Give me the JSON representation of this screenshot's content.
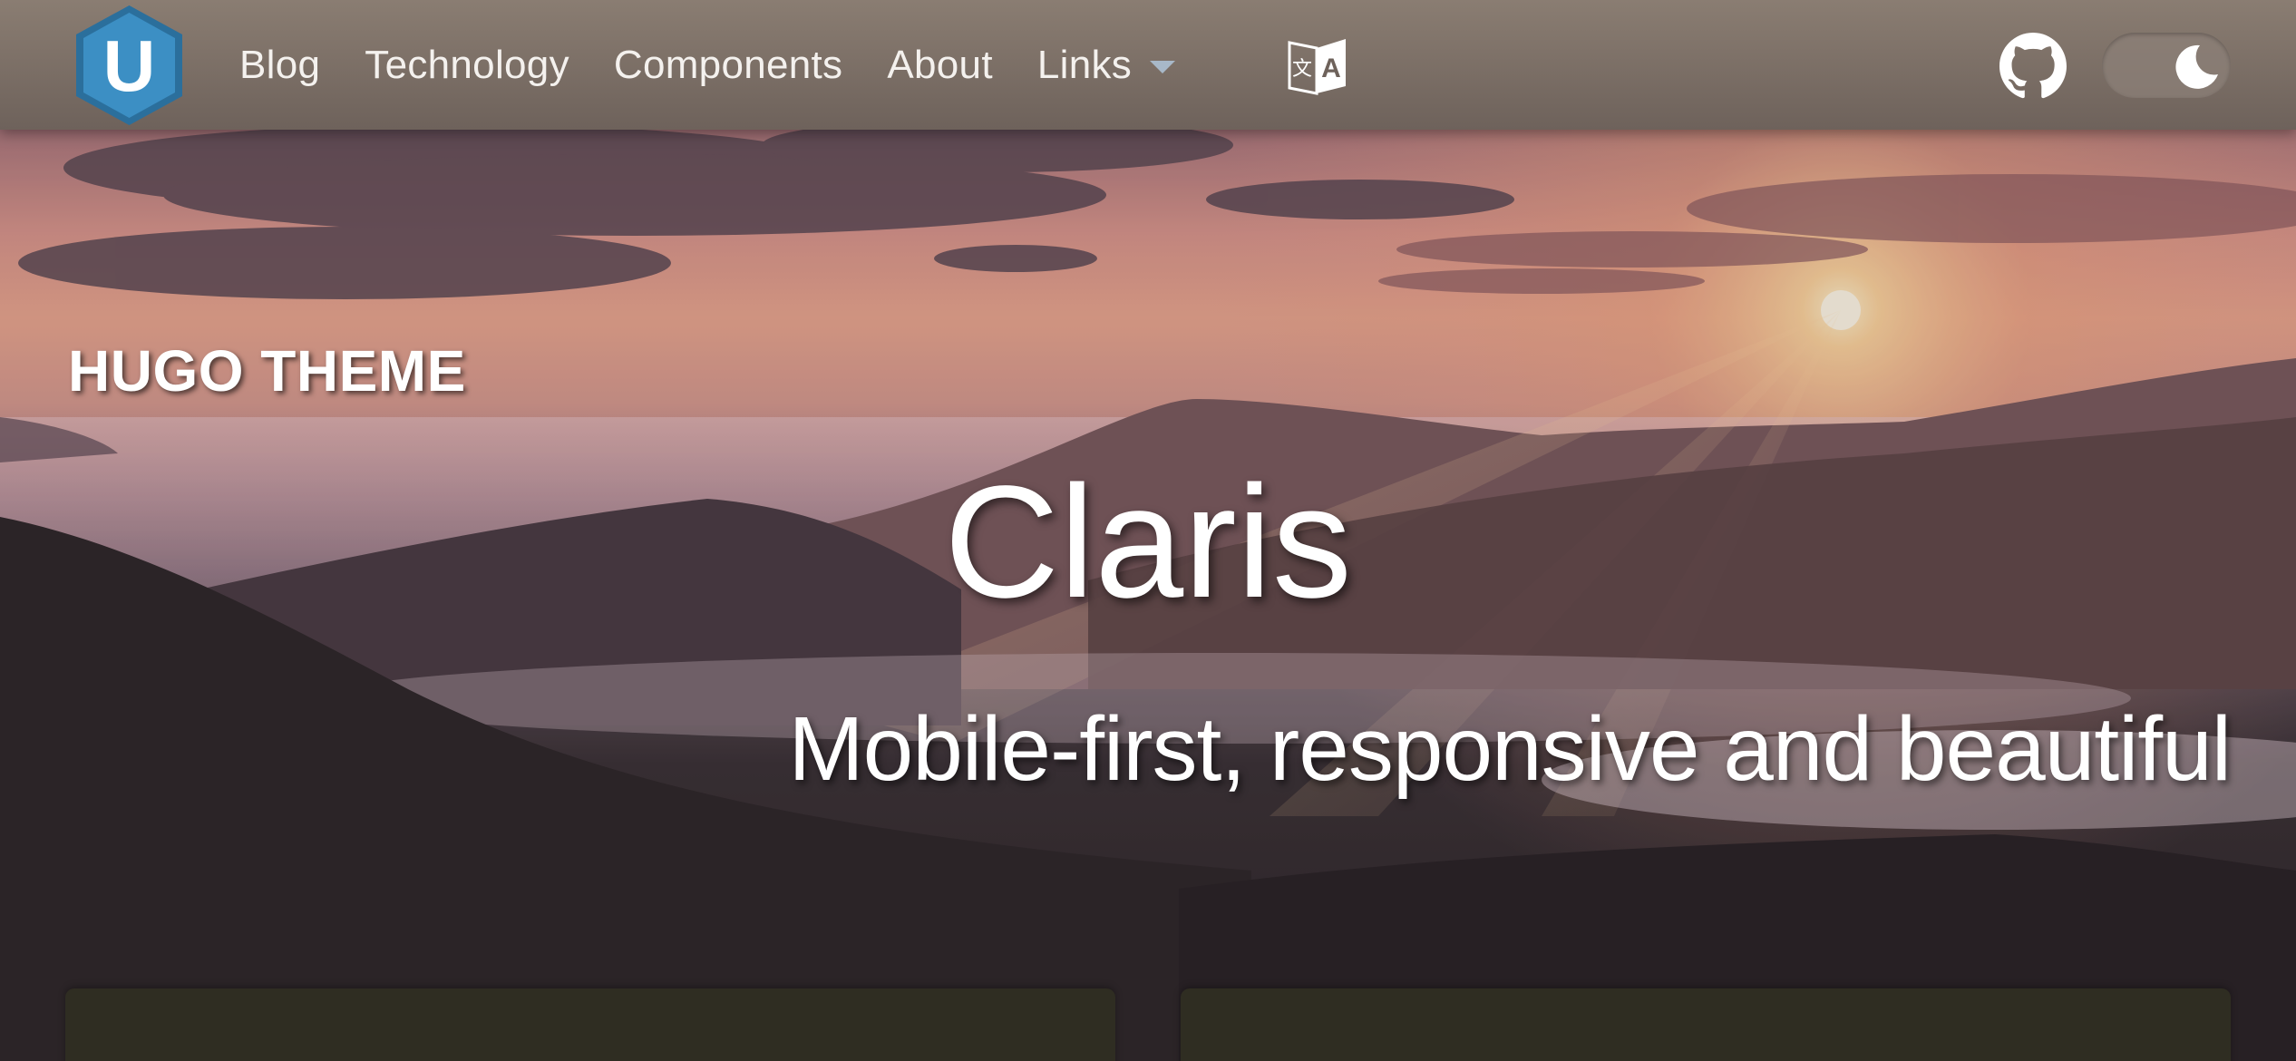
{
  "navbar": {
    "logo_letter": "U",
    "logo_color": "#3c8fc4",
    "items": [
      {
        "label": "Blog"
      },
      {
        "label": "Technology"
      },
      {
        "label": "Components"
      },
      {
        "label": "About"
      }
    ],
    "dropdown": {
      "label": "Links"
    },
    "icons": {
      "translate": "translate-icon",
      "github": "github-icon",
      "theme": "moon-icon"
    }
  },
  "hero": {
    "kicker": "HUGO THEME",
    "title": "Claris",
    "subtitle": "Mobile-first, responsive and beautiful"
  },
  "colors": {
    "navbar": "#7a6d64",
    "card": "#2f2d22",
    "text": "#ffffff"
  }
}
